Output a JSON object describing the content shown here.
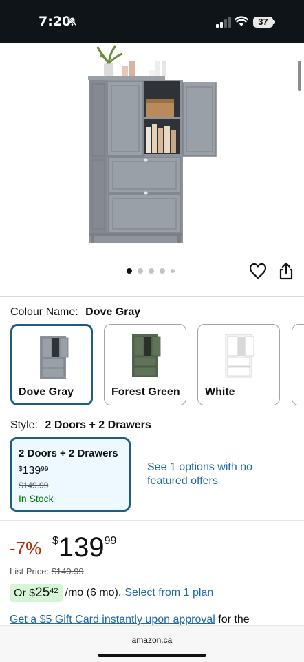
{
  "status_bar": {
    "time": "7:20",
    "battery": "37"
  },
  "product": {
    "image_icon": "storage-cabinet-image",
    "carousel_dots": 5,
    "carousel_active_index": 0
  },
  "colour": {
    "label": "Colour Name:",
    "selected": "Dove Gray",
    "options": [
      {
        "label": "Dove Gray",
        "color": "#8f949c"
      },
      {
        "label": "Forest Green",
        "color": "#56684f"
      },
      {
        "label": "White",
        "color": "#f4f4f4"
      }
    ]
  },
  "style": {
    "label": "Style:",
    "selected": "2 Doors + 2 Drawers",
    "option": {
      "title": "2 Doors + 2 Drawers",
      "price_currency": "$",
      "price_whole": "139",
      "price_cents": "99",
      "list_price": "$149.99",
      "stock": "In Stock"
    },
    "see_options": "See 1 options with no featured offers"
  },
  "pricing": {
    "discount": "-7%",
    "currency": "$",
    "whole": "139",
    "cents": "99",
    "list_price_label": "List Price:",
    "list_price_value": "$149.99",
    "monthly_prefix": "Or $",
    "monthly_whole": "25",
    "monthly_cents": "42",
    "monthly_suffix": "/mo (6 mo).",
    "monthly_link": "Select from 1 plan",
    "gift_link": "Get a $5 Gift Card instantly upon approval",
    "gift_rest": "for the"
  },
  "browser": {
    "url": "amazon.ca"
  },
  "colors": {
    "accent_blue": "#1f6aa5",
    "selected_border": "#1d5d83",
    "discount_red": "#b12704",
    "in_stock_green": "#007600"
  }
}
